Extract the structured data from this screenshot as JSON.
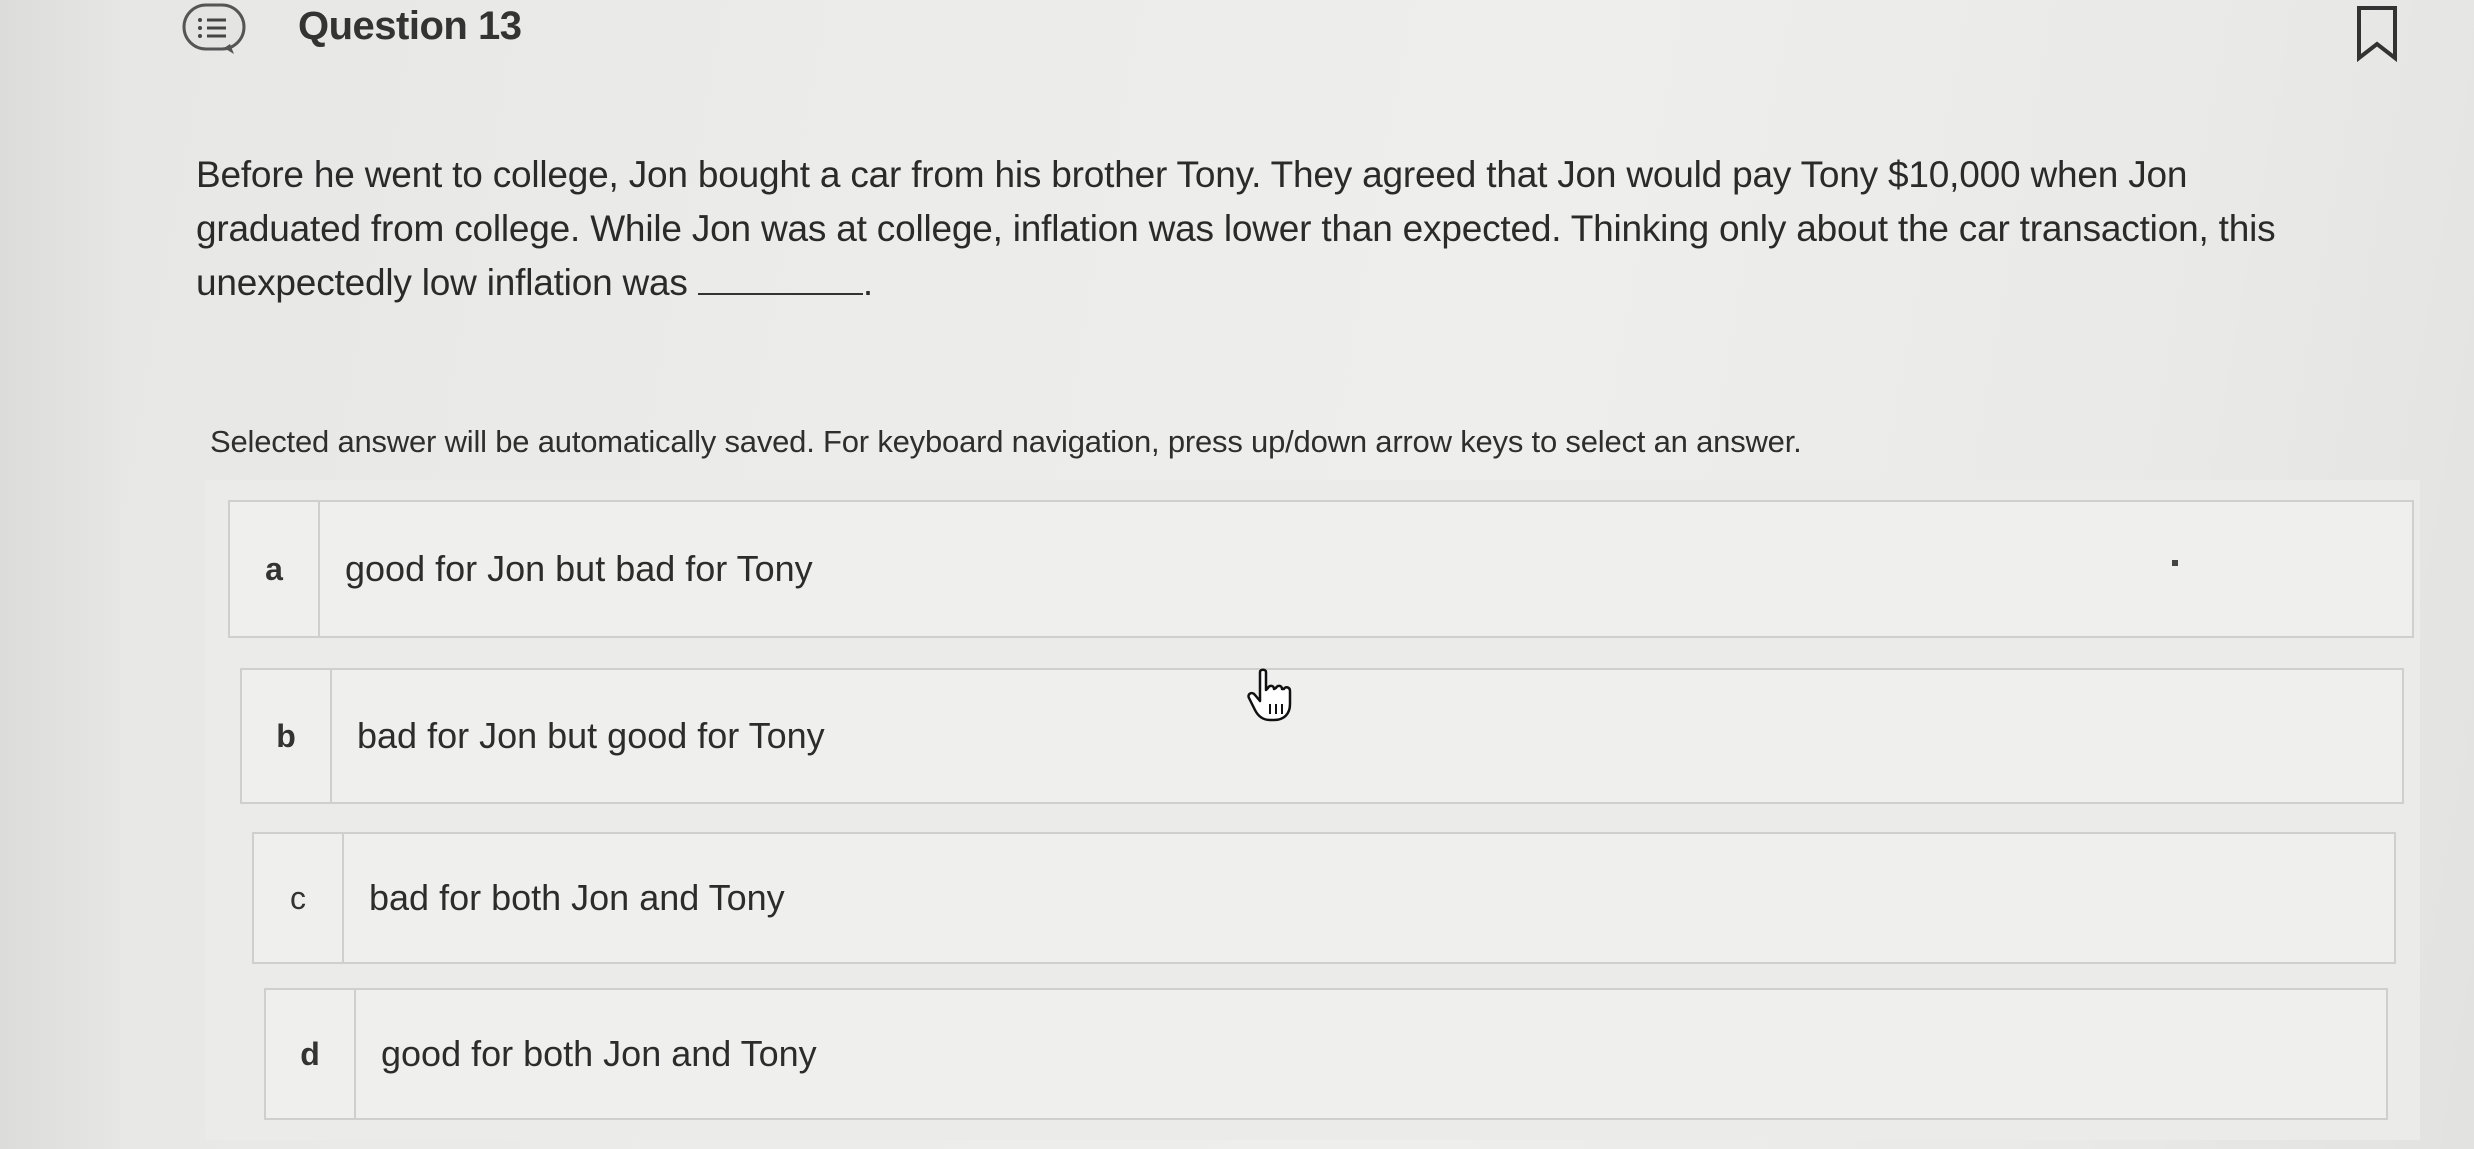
{
  "header": {
    "question_title": "Question 13"
  },
  "question": {
    "line1": "Before he went to college, Jon bought a car from his brother Tony. They agreed that Jon would pay Tony $10,000 when Jon",
    "line2": "graduated from college. While Jon was at college, inflation was lower than expected. Thinking only about the car transaction, this",
    "line3_prefix": "unexpectedly low inflation was",
    "line3_suffix": "."
  },
  "instruction": "Selected answer will be automatically saved. For keyboard navigation, press up/down arrow keys to select an answer.",
  "options": [
    {
      "letter": "a",
      "text": "good for Jon but bad for Tony"
    },
    {
      "letter": "b",
      "text": "bad for Jon but good for Tony"
    },
    {
      "letter": "c",
      "text": "bad for both Jon and Tony"
    },
    {
      "letter": "d",
      "text": "good for both Jon and Tony"
    }
  ],
  "icons": {
    "menu": "list-bubble-icon",
    "bookmark": "bookmark-icon",
    "cursor": "hand-pointer-icon"
  },
  "colors": {
    "background": "#ececea",
    "text": "#2b2b2b",
    "border": "#cfcfcd"
  }
}
